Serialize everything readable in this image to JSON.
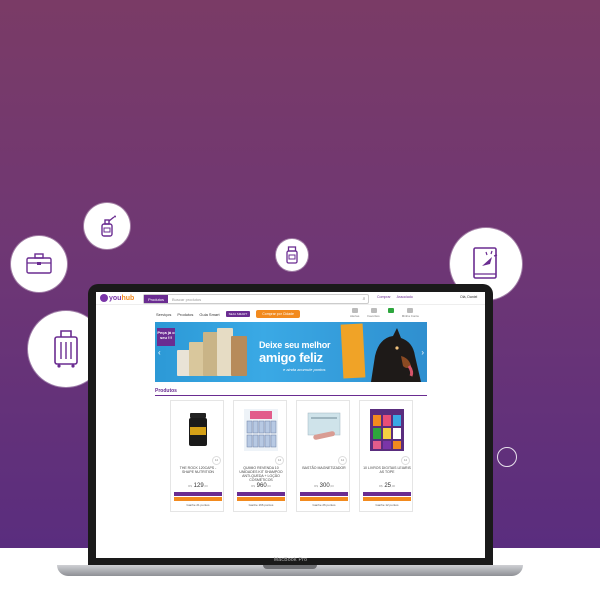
{
  "app": {
    "logo_you": "you",
    "logo_hub": "hub",
    "search_category": "Produtos",
    "search_placeholder": "Buscar produtos",
    "top_links": [
      "Comprar",
      "Associado"
    ],
    "user_greeting": "Olá, Daniel"
  },
  "nav": {
    "items": [
      "Serviços",
      "Produtos",
      "Guia Smart"
    ],
    "seja_label": "SEJA SMART",
    "comprar_label": "Comprar por Cidade",
    "icons": [
      {
        "icon": "bell-icon",
        "label": "Alertas"
      },
      {
        "icon": "heart-icon",
        "label": "Favoritos"
      },
      {
        "icon": "cart-icon",
        "label": ""
      },
      {
        "icon": "user-icon",
        "label": "Minha Conta"
      }
    ]
  },
  "banner": {
    "promo": "Peça já o seu !!!",
    "line1": "Deixe seu melhor",
    "line2": "amigo feliz",
    "line3": "e ainda acumule pontos"
  },
  "section": {
    "title": "Produtos"
  },
  "products": [
    {
      "name": "THE ROCK 120CAPS - SHAPE NUTRITION",
      "currency": "R$",
      "price_int": "129",
      "price_dec": ",00",
      "qty": "12",
      "earn": "Ganhe 21 pontos"
    },
    {
      "name": "QUIMIO REVENDA 10 UNIDADES KIT SHAMPOO ANTI-QUEDA + LOÇÃO COSMÉTICOS",
      "currency": "R$",
      "price_int": "960",
      "price_dec": ",00",
      "qty": "12",
      "earn": "Ganhe 166 pontos"
    },
    {
      "name": "BASTÃO MAGNETIZADOR",
      "currency": "R$",
      "price_int": "300",
      "price_dec": ",00",
      "qty": "12",
      "earn": "Ganhe 26 pontos"
    },
    {
      "name": "10 LIVROS DIGITAIS LEIARIS AS TOPE",
      "currency": "R$",
      "price_int": "25",
      "price_dec": ",00",
      "qty": "12",
      "earn": "Ganhe 12 pontos"
    }
  ],
  "laptop": {
    "brand": "MacBook Pro"
  },
  "colors": {
    "purple": "#6a2c91",
    "orange": "#f28a1e",
    "banner_blue": "#2c99d6"
  }
}
